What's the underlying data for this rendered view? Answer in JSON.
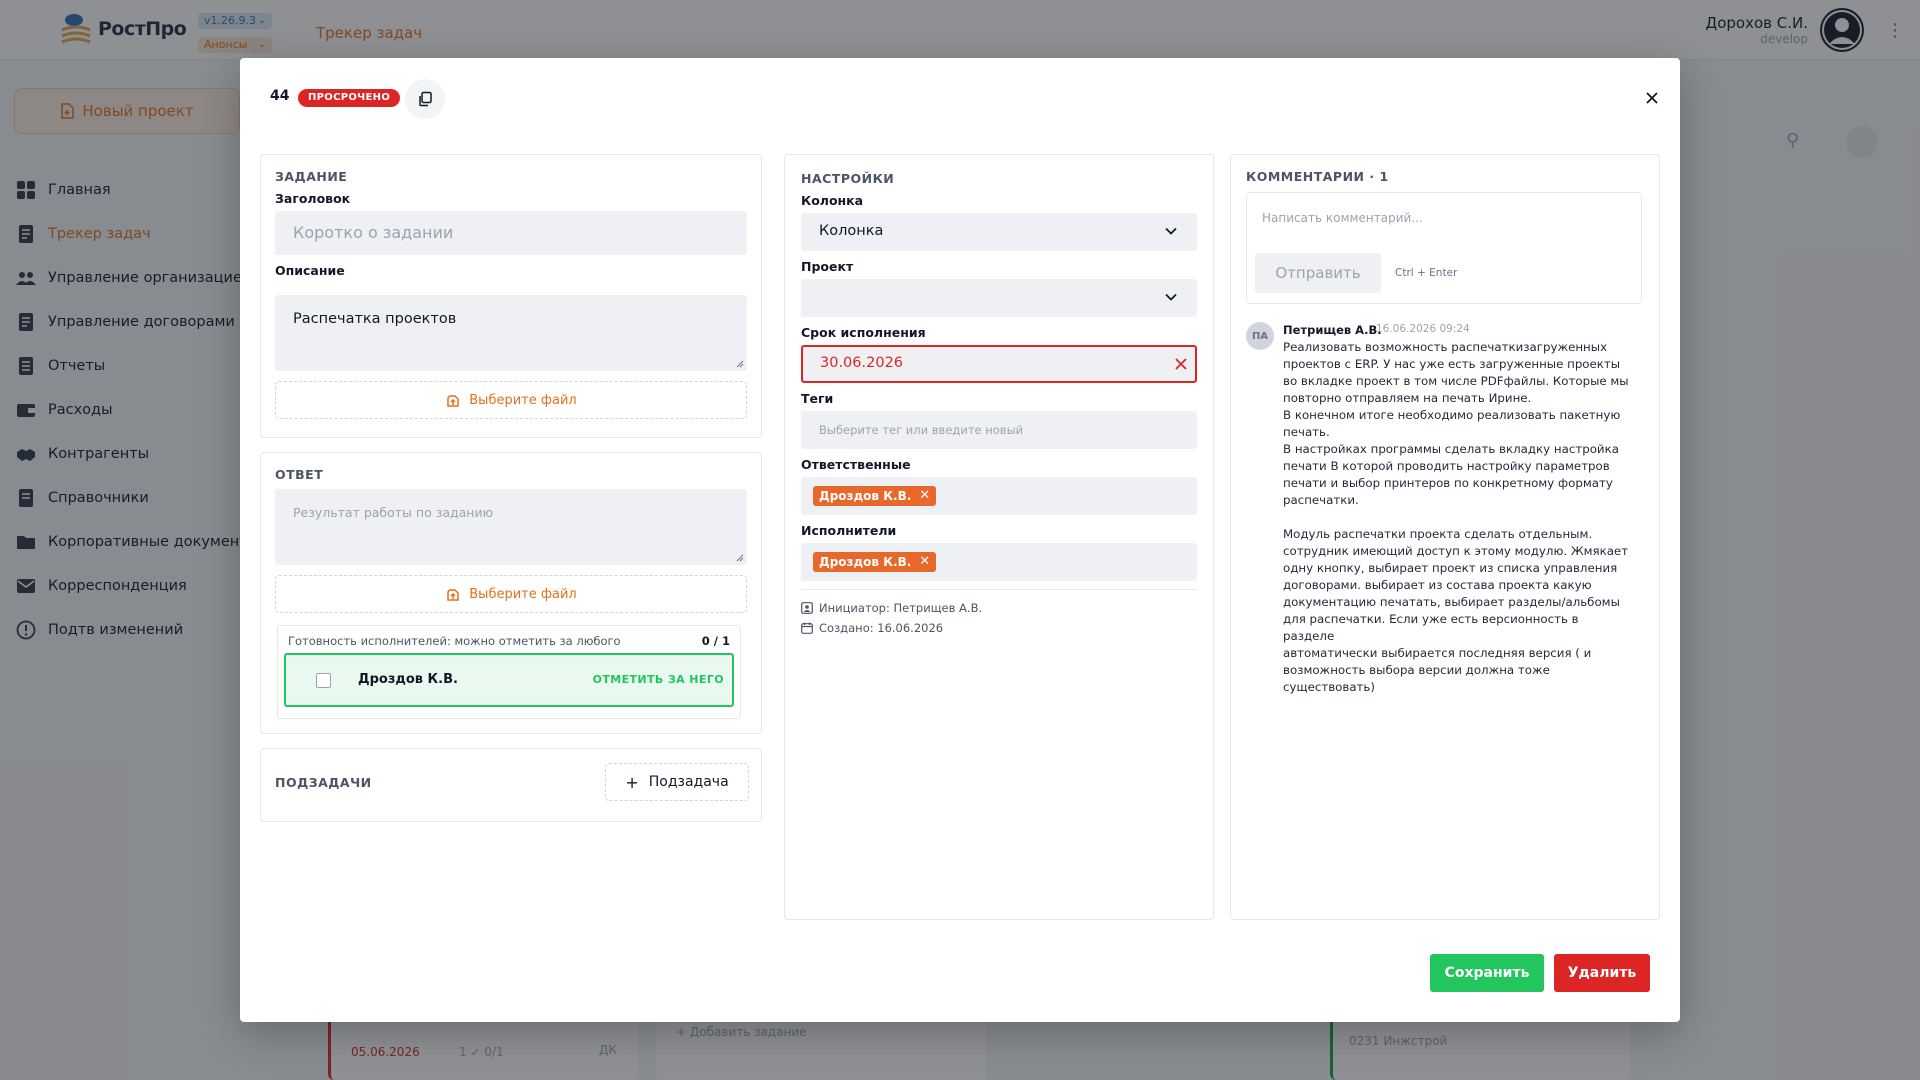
{
  "app": {
    "logo_text": "РостПро",
    "version": "v1.26.9.3",
    "announcements": "Анонсы",
    "section_title": "Трекер задач",
    "user_name": "Дорохов С.И.",
    "user_role": "develop",
    "new_project": "Новый проект",
    "brand_color": "#e2711d"
  },
  "sidebar": {
    "items": [
      {
        "label": "Главная",
        "icon": "grid-icon"
      },
      {
        "label": "Трекер задач",
        "icon": "document-icon",
        "active": true
      },
      {
        "label": "Управление организацией",
        "icon": "users-icon"
      },
      {
        "label": "Управление договорами",
        "icon": "document-icon"
      },
      {
        "label": "Отчеты",
        "icon": "list-icon"
      },
      {
        "label": "Расходы",
        "icon": "wallet-icon"
      },
      {
        "label": "Контрагенты",
        "icon": "handshake-icon"
      },
      {
        "label": "Справочники",
        "icon": "book-icon"
      },
      {
        "label": "Корпоративные документы",
        "icon": "folder-icon"
      },
      {
        "label": "Корреспонденция",
        "icon": "mail-icon"
      },
      {
        "label": "Подтв изменений",
        "icon": "alert-icon"
      }
    ]
  },
  "background": {
    "card1_date": "05.06.2026",
    "card1_meta": "1  ✓ 0/1",
    "card1_avatar": "ДК",
    "add_task": "+ Добавить задание",
    "card3_text": "0231 Инжстрой"
  },
  "modal": {
    "task_number": "44",
    "status_badge": "ПРОСРОЧЕНО",
    "task": {
      "section": "ЗАДАНИЕ",
      "title_label": "Заголовок",
      "title_placeholder": "Коротко о задании",
      "description_label": "Описание",
      "description_value": "Распечатка проектов",
      "file_button": "Выберите файл"
    },
    "answer": {
      "section": "ОТВЕТ",
      "placeholder": "Результат работы по заданию",
      "file_button": "Выберите файл",
      "readiness_title": "Готовность исполнителей: можно отметить за любого",
      "readiness_count": "0 / 1",
      "executor_name": "Дроздов К.В.",
      "mark_button": "ОТМЕТИТЬ ЗА НЕГО"
    },
    "subtasks": {
      "section": "ПОДЗАДАЧИ",
      "add_button": "Подзадача"
    },
    "settings": {
      "section": "НАСТРОЙКИ",
      "column_label": "Колонка",
      "column_value": "Колонка",
      "project_label": "Проект",
      "project_value": "",
      "deadline_label": "Срок исполнения",
      "deadline_value": "30.06.2026",
      "tags_label": "Теги",
      "tags_placeholder": "Выберите тег или введите новый",
      "responsible_label": "Ответственные",
      "responsible_chip": "Дроздов К.В.",
      "executors_label": "Исполнители",
      "executors_chip": "Дроздов К.В.",
      "initiator": "Инициатор: Петрищев А.В.",
      "created": "Создано: 16.06.2026"
    },
    "comments": {
      "section": "КОММЕНТАРИИ · 1",
      "placeholder": "Написать комментарий...",
      "send_button": "Отправить",
      "send_hint": "Ctrl + Enter",
      "items": [
        {
          "avatar": "ПА",
          "author": "Петрищев А.В.",
          "date": "16.06.2026 09:24",
          "text": "Реализовать возможность распечаткизагруженных\nпроектов с ERP. У нас уже есть загруженные проекты\nво вкладке проект в том числе PDFфайлы. Которые мы\nповторно отправляем на печать Ирине.\nВ конечном итоге необходимо реализовать пакетную\nпечать.\nВ настройках программы сделать вкладку настройка\nпечати В которой проводить настройку параметров\nпечати и выбор принтеров по конкретному формату\nраспечатки.\n\nМодуль распечатки проекта сделать отдельным.\nсотрудник имеющий доступ к этому модулю. Жмякает\nодну кнопку, выбирает проект из списка управления\nдоговорами. выбирает из состава проекта какую\nдокументацию печатать, выбирает разделы/альбомы\nдля распечатки. Если уже есть версионность в разделе\nавтоматически выбирается последняя версия ( и\nвозможность выбора версии должна тоже\nсуществовать)"
        }
      ]
    },
    "save_button": "Сохранить",
    "delete_button": "Удалить"
  }
}
